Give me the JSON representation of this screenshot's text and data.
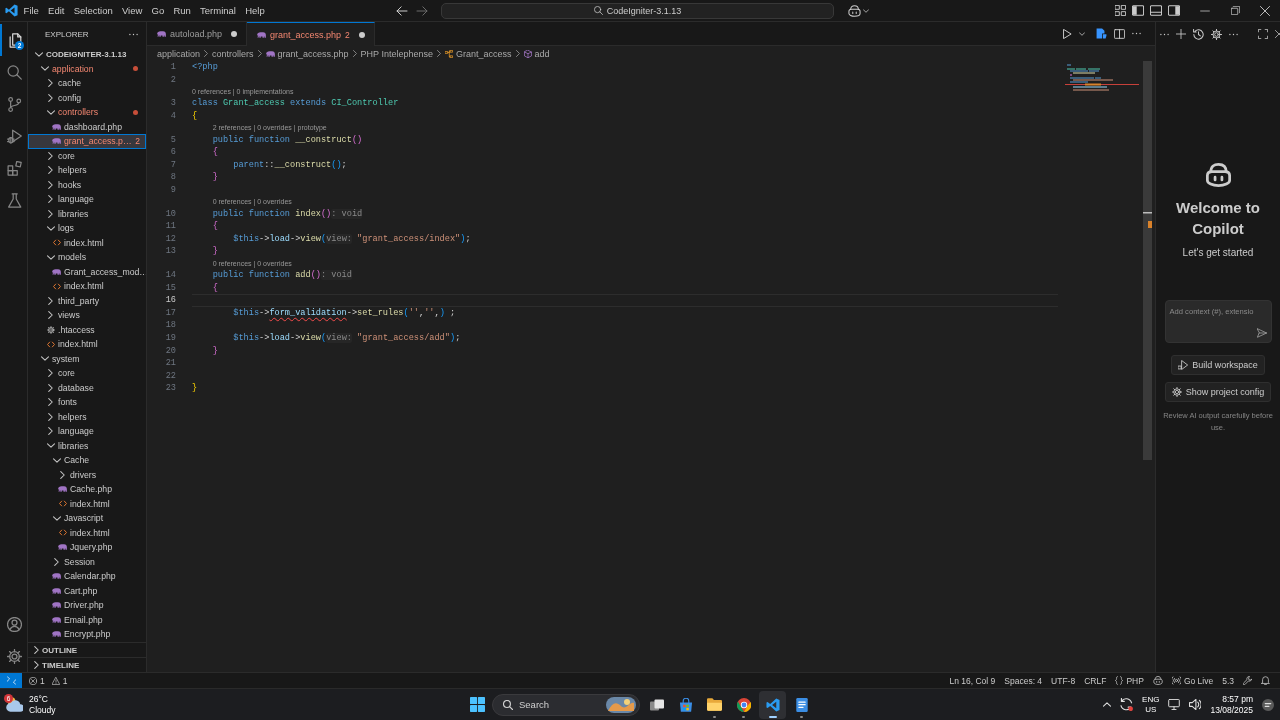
{
  "title_bar": {
    "menu": [
      "File",
      "Edit",
      "Selection",
      "View",
      "Go",
      "Run",
      "Terminal",
      "Help"
    ],
    "search": "CodeIgniter-3.1.13"
  },
  "activity_bar": {
    "items": [
      {
        "selected": true,
        "badge": "2"
      },
      {
        "selected": false
      },
      {
        "selected": false
      },
      {
        "selected": false
      },
      {
        "selected": false
      },
      {
        "selected": false
      }
    ]
  },
  "explorer": {
    "title": "EXPLORER",
    "tree": [
      {
        "label": "CODEIGNITER-3.1.13",
        "kind": "root",
        "expanded": true,
        "selected": false,
        "error": false,
        "children": [
          {
            "label": "application",
            "kind": "folder",
            "expanded": true,
            "selected": false,
            "error": true,
            "children": [
              {
                "label": "cache",
                "kind": "folder",
                "expanded": false,
                "selected": false,
                "error": false
              },
              {
                "label": "config",
                "kind": "folder",
                "expanded": false,
                "selected": false,
                "error": false
              },
              {
                "label": "controllers",
                "kind": "folder",
                "expanded": true,
                "selected": false,
                "error": true,
                "children": [
                  {
                    "label": "dashboard.php",
                    "kind": "php",
                    "selected": false,
                    "error": false
                  },
                  {
                    "label": "grant_access.p…",
                    "kind": "php",
                    "selected": true,
                    "error": true,
                    "problems": "2"
                  }
                ]
              },
              {
                "label": "core",
                "kind": "folder",
                "expanded": false,
                "selected": false,
                "error": false
              },
              {
                "label": "helpers",
                "kind": "folder",
                "expanded": false,
                "selected": false,
                "error": false
              },
              {
                "label": "hooks",
                "kind": "folder",
                "expanded": false,
                "selected": false,
                "error": false
              },
              {
                "label": "language",
                "kind": "folder",
                "expanded": false,
                "selected": false,
                "error": false
              },
              {
                "label": "libraries",
                "kind": "folder",
                "expanded": false,
                "selected": false,
                "error": false
              },
              {
                "label": "logs",
                "kind": "folder",
                "expanded": true,
                "selected": false,
                "error": false,
                "children": [
                  {
                    "label": "index.html",
                    "kind": "html",
                    "selected": false,
                    "error": false
                  }
                ]
              },
              {
                "label": "models",
                "kind": "folder",
                "expanded": true,
                "selected": false,
                "error": false,
                "children": [
                  {
                    "label": "Grant_access_mod…",
                    "kind": "php",
                    "selected": false,
                    "error": false
                  },
                  {
                    "label": "index.html",
                    "kind": "html",
                    "selected": false,
                    "error": false
                  }
                ]
              },
              {
                "label": "third_party",
                "kind": "folder",
                "expanded": false,
                "selected": false,
                "error": false
              },
              {
                "label": "views",
                "kind": "folder",
                "expanded": false,
                "selected": false,
                "error": false
              },
              {
                "label": ".htaccess",
                "kind": "config",
                "selected": false,
                "error": false
              },
              {
                "label": "index.html",
                "kind": "html",
                "selected": false,
                "error": false
              }
            ]
          },
          {
            "label": "system",
            "kind": "folder",
            "expanded": true,
            "selected": false,
            "error": false,
            "children": [
              {
                "label": "core",
                "kind": "folder",
                "expanded": false,
                "selected": false,
                "error": false
              },
              {
                "label": "database",
                "kind": "folder",
                "expanded": false,
                "selected": false,
                "error": false
              },
              {
                "label": "fonts",
                "kind": "folder",
                "expanded": false,
                "selected": false,
                "error": false
              },
              {
                "label": "helpers",
                "kind": "folder",
                "expanded": false,
                "selected": false,
                "error": false
              },
              {
                "label": "language",
                "kind": "folder",
                "expanded": false,
                "selected": false,
                "error": false
              },
              {
                "label": "libraries",
                "kind": "folder",
                "expanded": true,
                "selected": false,
                "error": false,
                "children": [
                  {
                    "label": "Cache",
                    "kind": "folder",
                    "expanded": true,
                    "selected": false,
                    "error": false,
                    "children": [
                      {
                        "label": "drivers",
                        "kind": "folder",
                        "expanded": false,
                        "selected": false,
                        "error": false
                      },
                      {
                        "label": "Cache.php",
                        "kind": "php",
                        "selected": false,
                        "error": false
                      },
                      {
                        "label": "index.html",
                        "kind": "html",
                        "selected": false,
                        "error": false
                      }
                    ]
                  },
                  {
                    "label": "Javascript",
                    "kind": "folder",
                    "expanded": true,
                    "selected": false,
                    "error": false,
                    "children": [
                      {
                        "label": "index.html",
                        "kind": "html",
                        "selected": false,
                        "error": false
                      },
                      {
                        "label": "Jquery.php",
                        "kind": "php",
                        "selected": false,
                        "error": false
                      }
                    ]
                  },
                  {
                    "label": "Session",
                    "kind": "folder",
                    "expanded": false,
                    "selected": false,
                    "error": false
                  },
                  {
                    "label": "Calendar.php",
                    "kind": "php",
                    "selected": false,
                    "error": false
                  },
                  {
                    "label": "Cart.php",
                    "kind": "php",
                    "selected": false,
                    "error": false
                  },
                  {
                    "label": "Driver.php",
                    "kind": "php",
                    "selected": false,
                    "error": false
                  },
                  {
                    "label": "Email.php",
                    "kind": "php",
                    "selected": false,
                    "error": false
                  },
                  {
                    "label": "Encrypt.php",
                    "kind": "php",
                    "selected": false,
                    "error": false
                  }
                ]
              }
            ]
          }
        ]
      }
    ],
    "sections": [
      {
        "label": "OUTLINE",
        "expanded": false
      },
      {
        "label": "TIMELINE",
        "expanded": false
      }
    ]
  },
  "tabs": [
    {
      "label": "autoload.php",
      "kind": "php",
      "selected": false,
      "modified": true,
      "error": false
    },
    {
      "label": "grant_access.php",
      "kind": "php",
      "selected": true,
      "modified": true,
      "error": true,
      "problems": "2"
    }
  ],
  "breadcrumbs": [
    {
      "label": "application",
      "kind": "plain"
    },
    {
      "label": "controllers",
      "kind": "plain"
    },
    {
      "label": "grant_access.php",
      "kind": "php"
    },
    {
      "label": "PHP Intelephense",
      "kind": "plain"
    },
    {
      "label": "Grant_access",
      "kind": "class"
    },
    {
      "label": "add",
      "kind": "method"
    }
  ],
  "editor": {
    "lines": [
      {
        "number": "1",
        "current": false,
        "tokens": [
          {
            "text": "<?php",
            "kind": "tag",
            "error": false
          }
        ]
      },
      {
        "number": "2",
        "current": false
      },
      {
        "number": "3",
        "current": false,
        "codelens": "0 references | 0 implementations",
        "tokens": [
          {
            "text": "class",
            "kind": "keyword",
            "error": false
          },
          {
            "text": " Grant_access",
            "kind": "type",
            "error": false
          },
          {
            "text": " extends",
            "kind": "keyword",
            "error": false
          },
          {
            "text": " CI_Controller",
            "kind": "type",
            "error": false
          }
        ]
      },
      {
        "number": "4",
        "current": false,
        "tokens": [
          {
            "text": "{",
            "kind": "bracket1",
            "error": false
          }
        ]
      },
      {
        "number": "5",
        "current": false,
        "codelens": "2 references | 0 overrides | prototype",
        "tokens": [
          {
            "text": "    public function",
            "kind": "keyword",
            "error": false
          },
          {
            "text": " __construct",
            "kind": "function",
            "error": false
          },
          {
            "text": "()",
            "kind": "bracket2",
            "error": false
          }
        ]
      },
      {
        "number": "6",
        "current": false,
        "tokens": [
          {
            "text": "    {",
            "kind": "bracket2",
            "error": false
          }
        ]
      },
      {
        "number": "7",
        "current": false,
        "tokens": [
          {
            "text": "        parent",
            "kind": "keyword",
            "error": false
          },
          {
            "text": "::",
            "kind": "plain",
            "error": false
          },
          {
            "text": "__construct",
            "kind": "function",
            "error": false
          },
          {
            "text": "()",
            "kind": "bracket3",
            "error": false
          },
          {
            "text": ";",
            "kind": "plain",
            "error": false
          }
        ]
      },
      {
        "number": "8",
        "current": false,
        "tokens": [
          {
            "text": "    }",
            "kind": "bracket2",
            "error": false
          }
        ]
      },
      {
        "number": "9",
        "current": false
      },
      {
        "number": "10",
        "current": false,
        "codelens": "0 references | 0 overrides",
        "tokens": [
          {
            "text": "    public function",
            "kind": "keyword",
            "error": false
          },
          {
            "text": " index",
            "kind": "function",
            "error": false
          },
          {
            "text": "()",
            "kind": "bracket2",
            "error": false
          },
          {
            "text": ": void",
            "kind": "hint",
            "error": false
          }
        ]
      },
      {
        "number": "11",
        "current": false,
        "tokens": [
          {
            "text": "    {",
            "kind": "bracket2",
            "error": false
          }
        ]
      },
      {
        "number": "12",
        "current": false,
        "tokens": [
          {
            "text": "        $this",
            "kind": "keyword",
            "error": false
          },
          {
            "text": "->",
            "kind": "plain",
            "error": false
          },
          {
            "text": "load",
            "kind": "variable",
            "error": false
          },
          {
            "text": "->",
            "kind": "plain",
            "error": false
          },
          {
            "text": "view",
            "kind": "function",
            "error": false
          },
          {
            "text": "(",
            "kind": "bracket3",
            "error": false
          },
          {
            "text": "view:",
            "kind": "hint",
            "error": false
          },
          {
            "text": " \"grant_access/index\"",
            "kind": "string",
            "error": false
          },
          {
            "text": ")",
            "kind": "bracket3",
            "error": false
          },
          {
            "text": ";",
            "kind": "plain",
            "error": false
          }
        ]
      },
      {
        "number": "13",
        "current": false,
        "tokens": [
          {
            "text": "    }",
            "kind": "bracket2",
            "error": false
          }
        ]
      },
      {
        "number": "14",
        "current": false,
        "codelens": "0 references | 0 overrides",
        "tokens": [
          {
            "text": "    public function",
            "kind": "keyword",
            "error": false
          },
          {
            "text": " add",
            "kind": "function",
            "error": false
          },
          {
            "text": "()",
            "kind": "bracket2",
            "error": false
          },
          {
            "text": ": void",
            "kind": "hint",
            "error": false
          }
        ]
      },
      {
        "number": "15",
        "current": false,
        "tokens": [
          {
            "text": "    {",
            "kind": "bracket2",
            "error": false
          }
        ]
      },
      {
        "number": "16",
        "current": true
      },
      {
        "number": "17",
        "current": false,
        "tokens": [
          {
            "text": "        $this",
            "kind": "keyword",
            "error": false
          },
          {
            "text": "->",
            "kind": "plain",
            "error": false
          },
          {
            "text": "form_validation",
            "kind": "variable",
            "error": true
          },
          {
            "text": "->",
            "kind": "plain",
            "error": false
          },
          {
            "text": "set_rules",
            "kind": "function",
            "error": false
          },
          {
            "text": "(",
            "kind": "bracket3",
            "error": false
          },
          {
            "text": "''",
            "kind": "string",
            "error": false
          },
          {
            "text": ",",
            "kind": "plain",
            "error": false
          },
          {
            "text": "''",
            "kind": "string",
            "error": false
          },
          {
            "text": ",",
            "kind": "plain",
            "error": false
          },
          {
            "text": ")",
            "kind": "bracket3",
            "error": false
          },
          {
            "text": " ;",
            "kind": "plain",
            "error": false
          }
        ]
      },
      {
        "number": "18",
        "current": false
      },
      {
        "number": "19",
        "current": false,
        "tokens": [
          {
            "text": "        $this",
            "kind": "keyword",
            "error": false
          },
          {
            "text": "->",
            "kind": "plain",
            "error": false
          },
          {
            "text": "load",
            "kind": "variable",
            "error": false
          },
          {
            "text": "->",
            "kind": "plain",
            "error": false
          },
          {
            "text": "view",
            "kind": "function",
            "error": false
          },
          {
            "text": "(",
            "kind": "bracket3",
            "error": false
          },
          {
            "text": "view:",
            "kind": "hint",
            "error": false
          },
          {
            "text": " \"grant_access/add\"",
            "kind": "string",
            "error": false
          },
          {
            "text": ")",
            "kind": "bracket3",
            "error": false
          },
          {
            "text": ";",
            "kind": "plain",
            "error": false
          }
        ]
      },
      {
        "number": "20",
        "current": false,
        "tokens": [
          {
            "text": "    }",
            "kind": "bracket2",
            "error": false
          }
        ]
      },
      {
        "number": "21",
        "current": false
      },
      {
        "number": "22",
        "current": false
      },
      {
        "number": "23",
        "current": false,
        "tokens": [
          {
            "text": "}",
            "kind": "bracket1",
            "error": false
          }
        ]
      }
    ]
  },
  "copilot": {
    "title": "Welcome to Copilot",
    "subtitle": "Let's get started",
    "input": {
      "placeholder": "Add context (#), extensio"
    },
    "buttons": [
      {
        "label": "Build workspace"
      },
      {
        "label": "Show project config"
      }
    ],
    "disclaimer": "Review AI output carefully before use."
  },
  "status_bar": {
    "problems": {
      "errors": "1",
      "warnings": "1"
    },
    "items": [
      {
        "label": "Ln 16, Col 9",
        "kind": "text"
      },
      {
        "label": "Spaces: 4",
        "kind": "text"
      },
      {
        "label": "UTF-8",
        "kind": "text"
      },
      {
        "label": "CRLF",
        "kind": "text"
      },
      {
        "label": "PHP",
        "kind": "language"
      },
      {
        "kind": "copilot"
      },
      {
        "label": "Go Live",
        "kind": "live_server"
      },
      {
        "label": "5.3",
        "kind": "text"
      },
      {
        "kind": "tools"
      },
      {
        "kind": "notifications"
      }
    ]
  },
  "taskbar": {
    "weather": {
      "temperature": "26°C",
      "condition": "Cloudy",
      "badge": "6"
    },
    "search": {
      "label": "Search"
    },
    "apps": [
      {
        "running": false,
        "selected": false
      },
      {
        "running": false,
        "selected": false
      },
      {
        "running": true,
        "selected": false
      },
      {
        "running": true,
        "selected": false
      },
      {
        "running": true,
        "selected": true
      },
      {
        "running": true,
        "selected": false
      }
    ],
    "tray": {
      "language": "ENG",
      "region": "US",
      "time": "8:57 pm",
      "date": "13/08/2025"
    }
  }
}
